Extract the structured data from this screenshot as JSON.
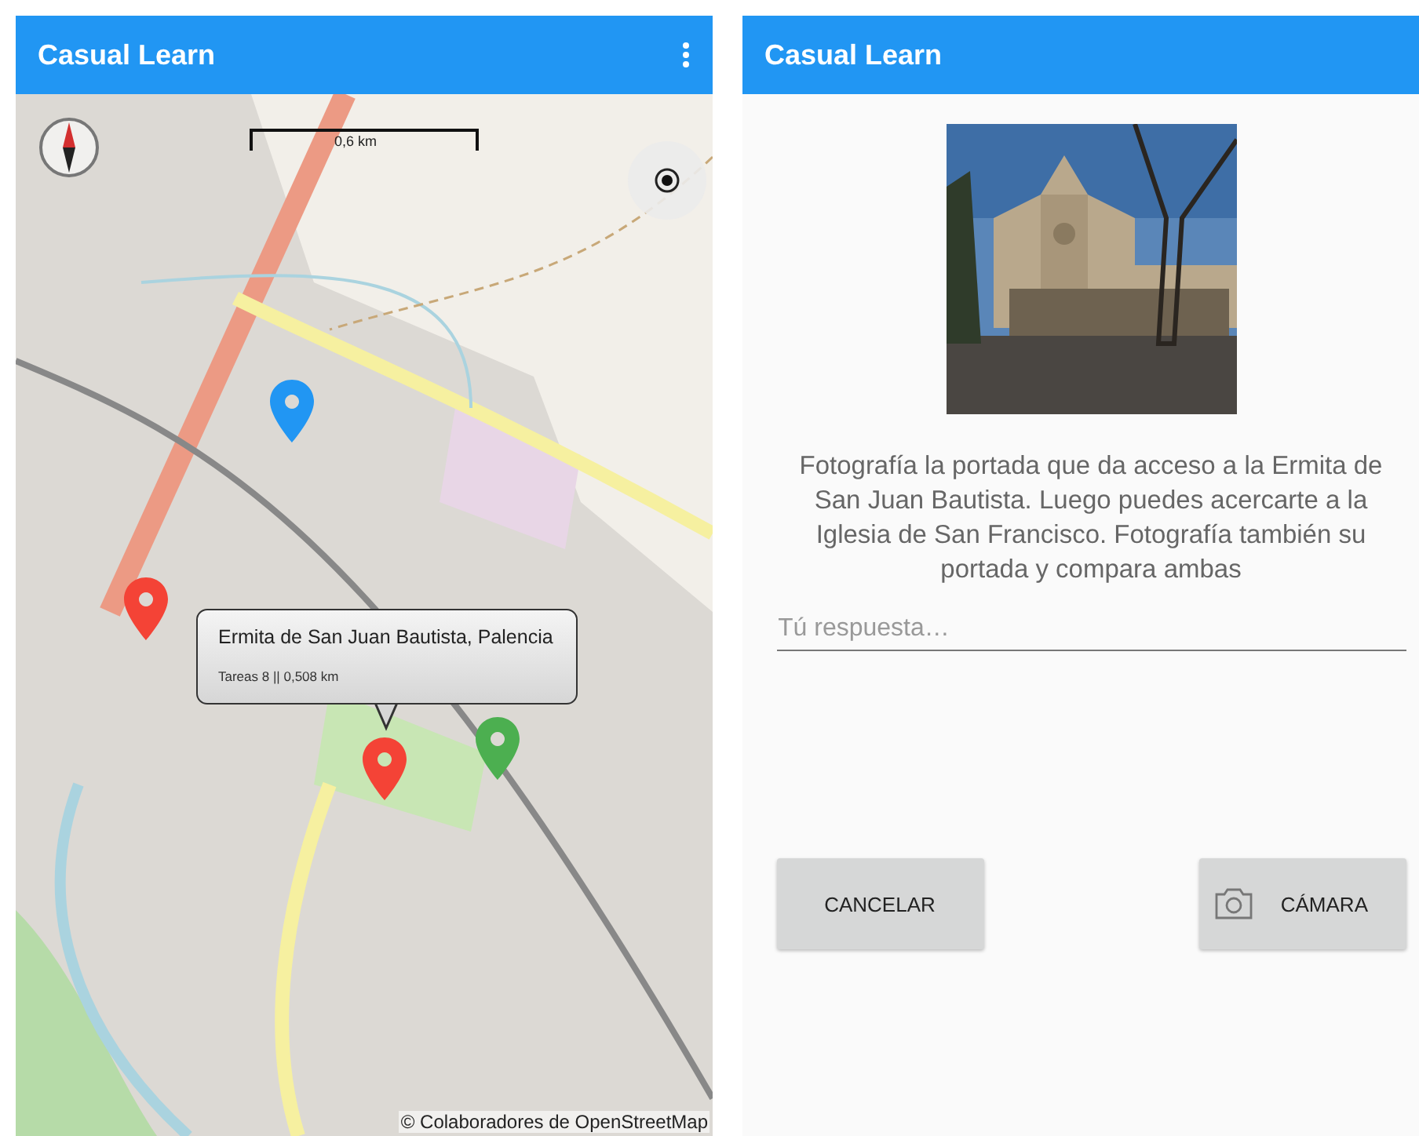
{
  "left_screen": {
    "app_bar": {
      "title": "Casual Learn"
    },
    "map": {
      "scale": "0,6 km",
      "markers": [
        {
          "color": "#2196f3"
        },
        {
          "color": "#f44336"
        },
        {
          "color": "#f44336"
        },
        {
          "color": "#4caf50"
        }
      ],
      "popup": {
        "title": "Ermita de San Juan Bautista, Palencia",
        "subtitle": "Tareas 8 || 0,508 km"
      },
      "attribution": "© Colaboradores de OpenStreetMap"
    }
  },
  "right_screen": {
    "app_bar": {
      "title": "Casual Learn"
    },
    "description": "Fotografía la portada que da acceso a la Ermita de San Juan Bautista. Luego puedes acercarte a la Iglesia de San Francisco. Fotografía también su portada y compara ambas",
    "answer": {
      "placeholder": "Tú respuesta…"
    },
    "buttons": [
      {
        "label": "CANCELAR",
        "kind": "plain"
      },
      {
        "label": "CÁMARA",
        "kind": "camera"
      }
    ]
  }
}
